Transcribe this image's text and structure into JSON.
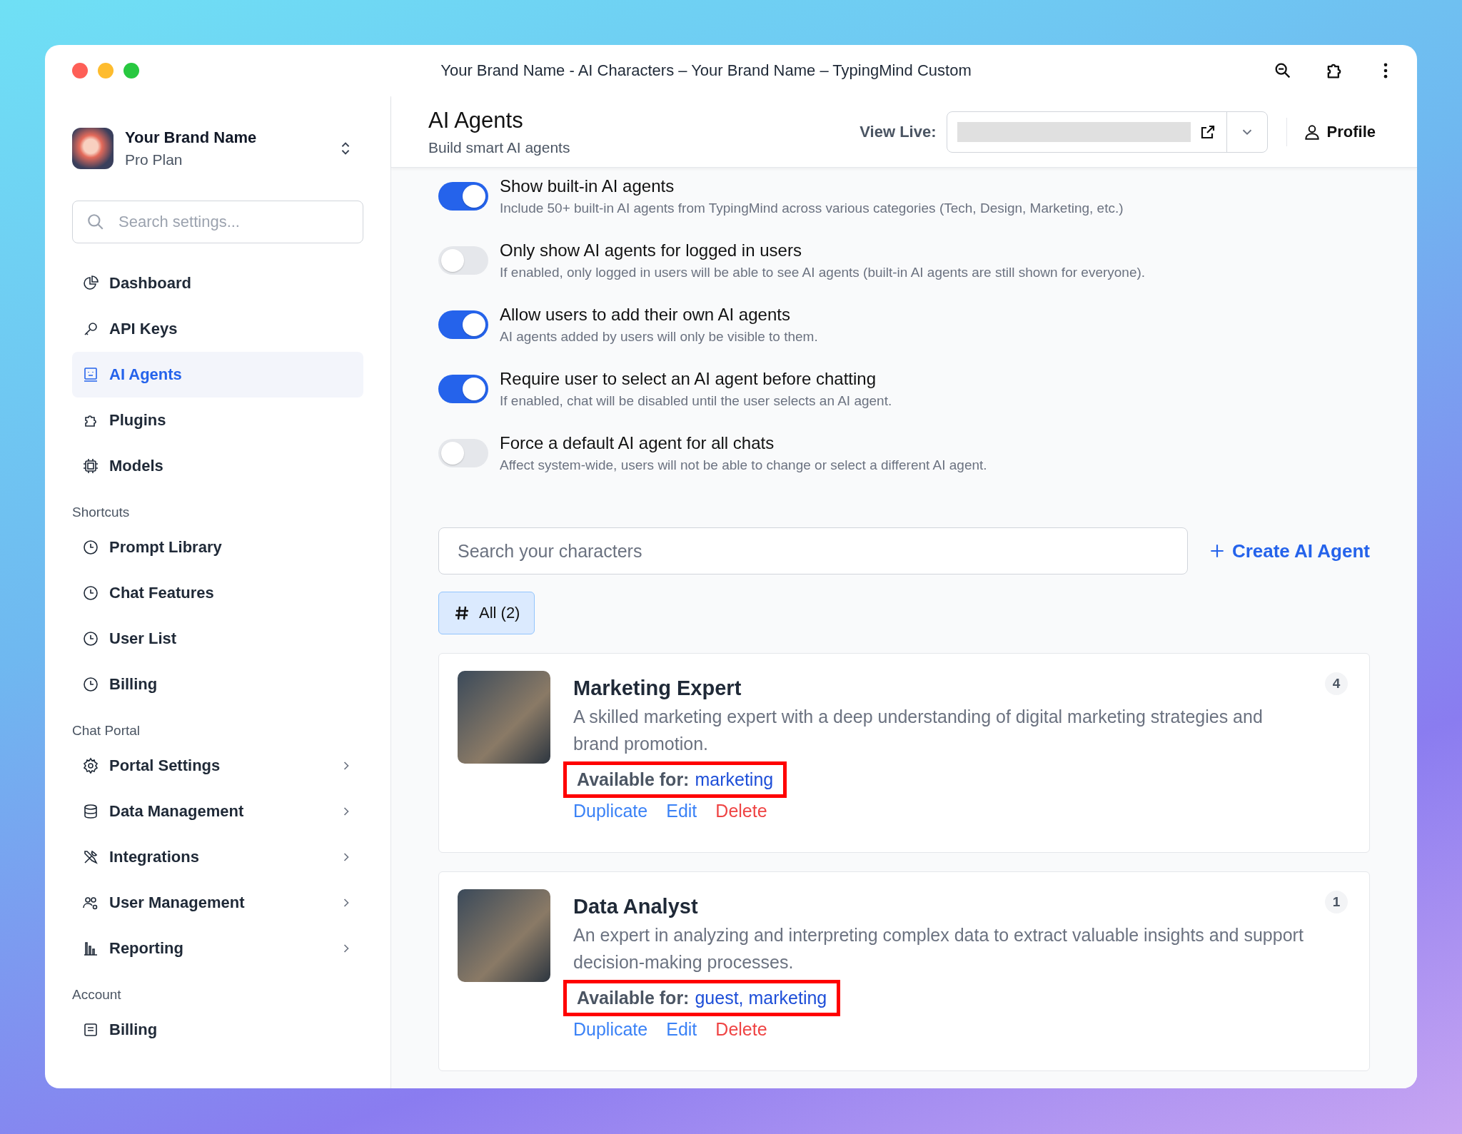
{
  "window": {
    "title": "Your Brand Name - AI Characters – Your Brand Name – TypingMind Custom"
  },
  "sidebar": {
    "brand": {
      "name": "Your Brand Name",
      "plan": "Pro Plan"
    },
    "search": {
      "placeholder": "Search settings..."
    },
    "sections": [
      {
        "items": [
          {
            "label": "Dashboard",
            "selected": false,
            "submenu": false
          },
          {
            "label": "API Keys",
            "selected": false,
            "submenu": false
          },
          {
            "label": "AI Agents",
            "selected": true,
            "submenu": false
          },
          {
            "label": "Plugins",
            "selected": false,
            "submenu": false
          },
          {
            "label": "Models",
            "selected": false,
            "submenu": false
          }
        ]
      },
      {
        "heading": "Shortcuts",
        "items": [
          {
            "label": "Prompt Library",
            "selected": false,
            "submenu": false
          },
          {
            "label": "Chat Features",
            "selected": false,
            "submenu": false
          },
          {
            "label": "User List",
            "selected": false,
            "submenu": false
          },
          {
            "label": "Billing",
            "selected": false,
            "submenu": false
          }
        ]
      },
      {
        "heading": "Chat Portal",
        "items": [
          {
            "label": "Portal Settings",
            "selected": false,
            "submenu": true
          },
          {
            "label": "Data Management",
            "selected": false,
            "submenu": true
          },
          {
            "label": "Integrations",
            "selected": false,
            "submenu": true
          },
          {
            "label": "User Management",
            "selected": false,
            "submenu": true
          },
          {
            "label": "Reporting",
            "selected": false,
            "submenu": true
          }
        ]
      },
      {
        "heading": "Account",
        "items": [
          {
            "label": "Billing",
            "selected": false,
            "submenu": false
          }
        ]
      }
    ]
  },
  "header": {
    "title": "AI Agents",
    "subtitle": "Build smart AI agents",
    "view_live_label": "View Live:",
    "profile_label": "Profile"
  },
  "settings": [
    {
      "title": "Show built-in AI agents",
      "description": "Include 50+ built-in AI agents from TypingMind across various categories (Tech, Design, Marketing, etc.)",
      "on": true
    },
    {
      "title": "Only show AI agents for logged in users",
      "description": "If enabled, only logged in users will be able to see AI agents (built-in AI agents are still shown for everyone).",
      "on": false
    },
    {
      "title": "Allow users to add their own AI agents",
      "description": "AI agents added by users will only be visible to them.",
      "on": true
    },
    {
      "title": "Require user to select an AI agent before chatting",
      "description": "If enabled, chat will be disabled until the user selects an AI agent.",
      "on": true
    },
    {
      "title": "Force a default AI agent for all chats",
      "description": "Affect system-wide, users will not be able to change or select a different AI agent.",
      "on": false
    }
  ],
  "character_search": {
    "placeholder": "Search your characters"
  },
  "create_button": "Create AI Agent",
  "filters": [
    {
      "label": "All (2)",
      "selected": true
    }
  ],
  "agents": [
    {
      "name": "Marketing Expert",
      "description": "A skilled marketing expert with a deep understanding of digital marketing strategies and brand promotion.",
      "available_label": "Available for:",
      "available_value": "marketing",
      "highlighted": true,
      "count": "4",
      "actions": [
        {
          "label": "Duplicate",
          "kind": "link"
        },
        {
          "label": "Edit",
          "kind": "link"
        },
        {
          "label": "Delete",
          "kind": "danger"
        }
      ]
    },
    {
      "name": "Data Analyst",
      "description": "An expert in analyzing and interpreting complex data to extract valuable insights and support decision-making processes.",
      "available_label": "Available for:",
      "available_value": "guest, marketing",
      "highlighted": true,
      "count": "1",
      "actions": [
        {
          "label": "Duplicate",
          "kind": "link"
        },
        {
          "label": "Edit",
          "kind": "link"
        },
        {
          "label": "Delete",
          "kind": "danger"
        }
      ]
    }
  ]
}
